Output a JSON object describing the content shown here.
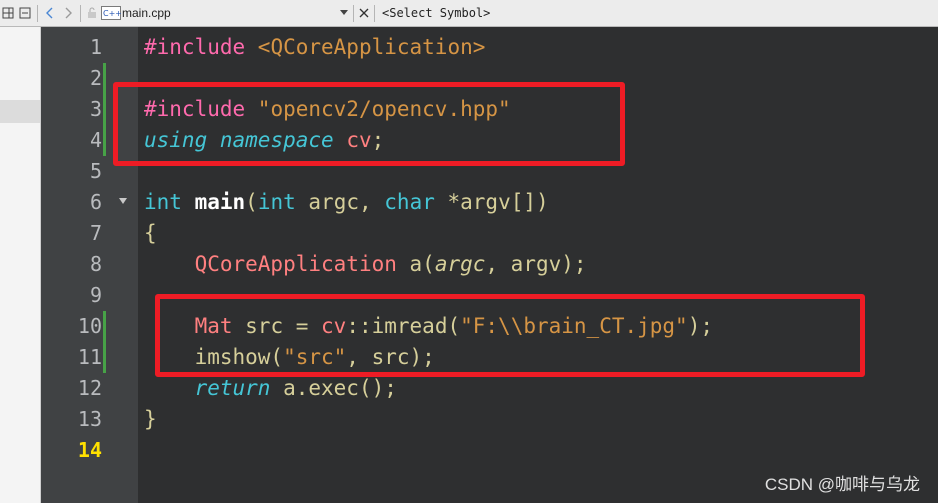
{
  "toolbar": {
    "file_name": "main.cpp",
    "file_type_badge": "C++",
    "symbol_placeholder": "<Select Symbol>",
    "icons": [
      "split-icon",
      "close-doc-icon",
      "back-arrow-icon",
      "forward-arrow-icon",
      "lock-icon",
      "cpp-file-icon",
      "dropdown-arrow-icon",
      "close-icon"
    ]
  },
  "editor": {
    "current_line": 14,
    "line_numbers": [
      "1",
      "2",
      "3",
      "4",
      "5",
      "6",
      "7",
      "8",
      "9",
      "10",
      "11",
      "12",
      "13",
      "14"
    ],
    "changed_lines": [
      2,
      3,
      4,
      10,
      11
    ],
    "lines": {
      "l1": {
        "a": "#include ",
        "b": "<QCoreApplication>"
      },
      "l3": {
        "a": "#include ",
        "b": "\"opencv2/opencv.hpp\""
      },
      "l4": {
        "a": "using",
        "b": " ",
        "c": "namespace",
        "d": " ",
        "e": "cv",
        "f": ";"
      },
      "l6": {
        "a": "int",
        "b": " ",
        "c": "main",
        "d": "(",
        "e": "int",
        "f": " argc, ",
        "g": "char",
        "h": " *argv[])"
      },
      "l7": {
        "a": "{"
      },
      "l8": {
        "a": "    ",
        "b": "QCoreApplication",
        "c": " a(",
        "d": "argc",
        "e": ", argv);"
      },
      "l10": {
        "a": "    ",
        "b": "Mat",
        "c": " src = ",
        "d": "cv",
        "e": "::imread(",
        "f": "\"F:\\\\brain_CT.jpg\"",
        "g": ");"
      },
      "l11": {
        "a": "    imshow(",
        "b": "\"src\"",
        "c": ", src);"
      },
      "l12": {
        "a": "    ",
        "b": "return",
        "c": " a.exec();"
      },
      "l13": {
        "a": "}"
      }
    }
  },
  "annotations": {
    "highlight_color": "#ee1c25"
  },
  "watermark": "CSDN @咖啡与乌龙"
}
